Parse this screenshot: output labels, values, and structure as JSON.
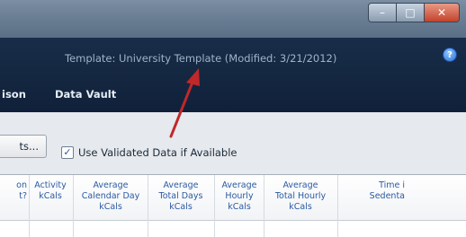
{
  "window": {
    "minimize_glyph": "–",
    "maximize_glyph": "□",
    "close_glyph": "✕"
  },
  "header": {
    "template_info": "Template: University Template (Modified: 3/21/2012)",
    "help_glyph": "?"
  },
  "nav": {
    "items": [
      "ison",
      "Data Vault"
    ]
  },
  "toolbar": {
    "button_label": "ts...",
    "checkbox_glyph": "✓",
    "checkbox_label": "Use Validated Data if Available"
  },
  "grid": {
    "columns": [
      "on\nt?",
      "Activity\nkCals",
      "Average\nCalendar Day\nkCals",
      "Average\nTotal Days\nkCals",
      "Average\nHourly\nkCals",
      "Average\nTotal Hourly\nkCals",
      "Time i\nSedenta"
    ]
  },
  "annotation": {
    "arrow_color": "#c0282a"
  }
}
